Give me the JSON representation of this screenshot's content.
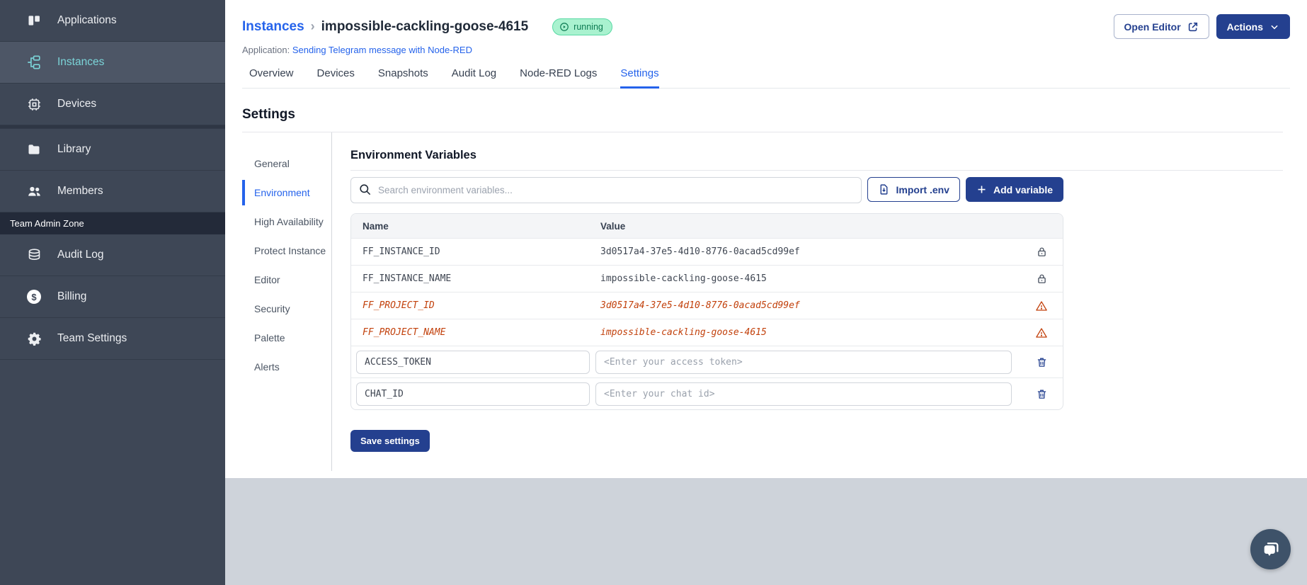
{
  "sidebar": {
    "items": [
      {
        "label": "Applications"
      },
      {
        "label": "Instances",
        "active": true
      },
      {
        "label": "Devices"
      },
      {
        "label": "Library"
      },
      {
        "label": "Members"
      }
    ],
    "admin_zone_label": "Team Admin Zone",
    "admin_items": [
      {
        "label": "Audit Log"
      },
      {
        "label": "Billing"
      },
      {
        "label": "Team Settings"
      }
    ]
  },
  "header": {
    "breadcrumb_parent": "Instances",
    "breadcrumb_separator": "›",
    "instance_name": "impossible-cackling-goose-4615",
    "status_badge": "running",
    "application_label": "Application:",
    "application_link": "Sending Telegram message with Node-RED",
    "open_editor_label": "Open Editor",
    "actions_label": "Actions"
  },
  "tabs": {
    "items": [
      "Overview",
      "Devices",
      "Snapshots",
      "Audit Log",
      "Node-RED Logs",
      "Settings"
    ],
    "active": "Settings"
  },
  "settings": {
    "page_title": "Settings",
    "subnav": [
      "General",
      "Environment",
      "High Availability",
      "Protect Instance",
      "Editor",
      "Security",
      "Palette",
      "Alerts"
    ],
    "subnav_active": "Environment",
    "section_title": "Environment Variables",
    "search_placeholder": "Search environment variables...",
    "import_button": "Import .env",
    "add_button": "Add variable",
    "save_button": "Save settings",
    "table": {
      "columns": [
        "Name",
        "Value"
      ],
      "rows": [
        {
          "name": "FF_INSTANCE_ID",
          "value": "3d0517a4-37e5-4d10-8776-0acad5cd99ef",
          "state": "locked"
        },
        {
          "name": "FF_INSTANCE_NAME",
          "value": "impossible-cackling-goose-4615",
          "state": "locked"
        },
        {
          "name": "FF_PROJECT_ID",
          "value": "3d0517a4-37e5-4d10-8776-0acad5cd99ef",
          "state": "deprecated"
        },
        {
          "name": "FF_PROJECT_NAME",
          "value": "impossible-cackling-goose-4615",
          "state": "deprecated"
        },
        {
          "name": "ACCESS_TOKEN",
          "value": "",
          "value_placeholder": "<Enter your access token>",
          "state": "editable"
        },
        {
          "name": "CHAT_ID",
          "value": "",
          "value_placeholder": "<Enter your chat id>",
          "state": "editable"
        }
      ]
    }
  },
  "colors": {
    "accent_blue": "#2563eb",
    "primary_button_blue": "#24408f",
    "sidebar_bg": "#3e4756",
    "sidebar_active_text": "#7bd4d8",
    "status_running_bg": "#a9f2cf",
    "status_running_text": "#0d7a52",
    "deprecated_orange": "#c2410c",
    "footer_bg": "#ced3da"
  }
}
